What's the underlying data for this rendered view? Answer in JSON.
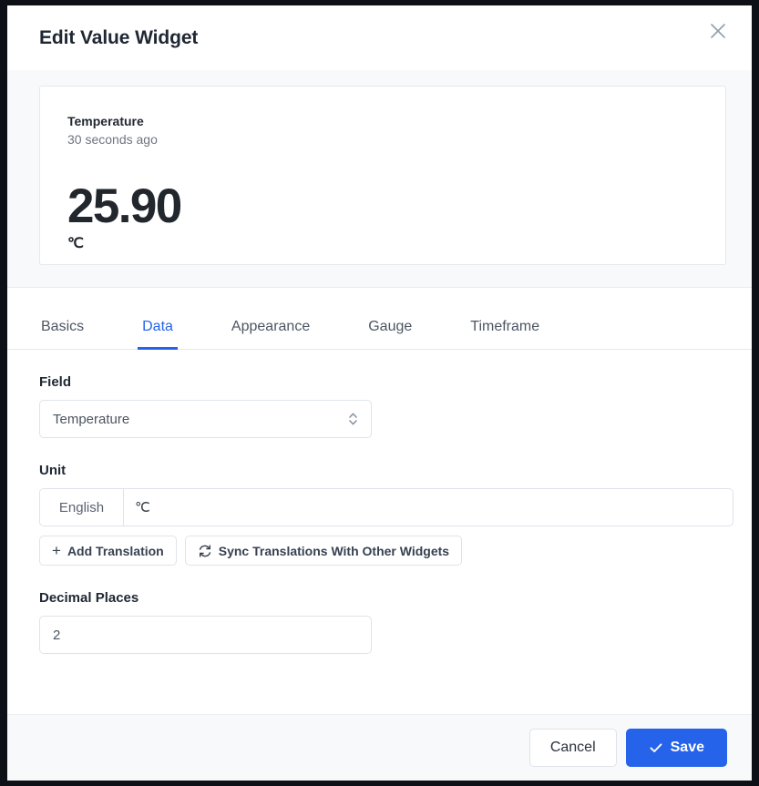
{
  "header": {
    "title": "Edit Value Widget",
    "close_icon": "close-icon"
  },
  "preview": {
    "title": "Temperature",
    "timestamp": "30 seconds ago",
    "value": "25.90",
    "unit": "℃"
  },
  "tabs": [
    {
      "label": "Basics",
      "active": false
    },
    {
      "label": "Data",
      "active": true
    },
    {
      "label": "Appearance",
      "active": false
    },
    {
      "label": "Gauge",
      "active": false
    },
    {
      "label": "Timeframe",
      "active": false
    }
  ],
  "form": {
    "field": {
      "label": "Field",
      "value": "Temperature",
      "icon": "chevron-up-down-icon"
    },
    "unit": {
      "label": "Unit",
      "language": "English",
      "value": "℃",
      "add_translation_label": "Add Translation",
      "add_translation_icon": "plus-icon",
      "sync_label": "Sync Translations With Other Widgets",
      "sync_icon": "sync-icon"
    },
    "decimal_places": {
      "label": "Decimal Places",
      "value": "2"
    }
  },
  "footer": {
    "cancel_label": "Cancel",
    "save_label": "Save",
    "save_icon": "check-icon"
  },
  "colors": {
    "accent": "#2563eb",
    "panel_bg": "#f8f9fb",
    "text": "#1f2733",
    "muted": "#6d7581",
    "border": "#dfe3e9"
  }
}
